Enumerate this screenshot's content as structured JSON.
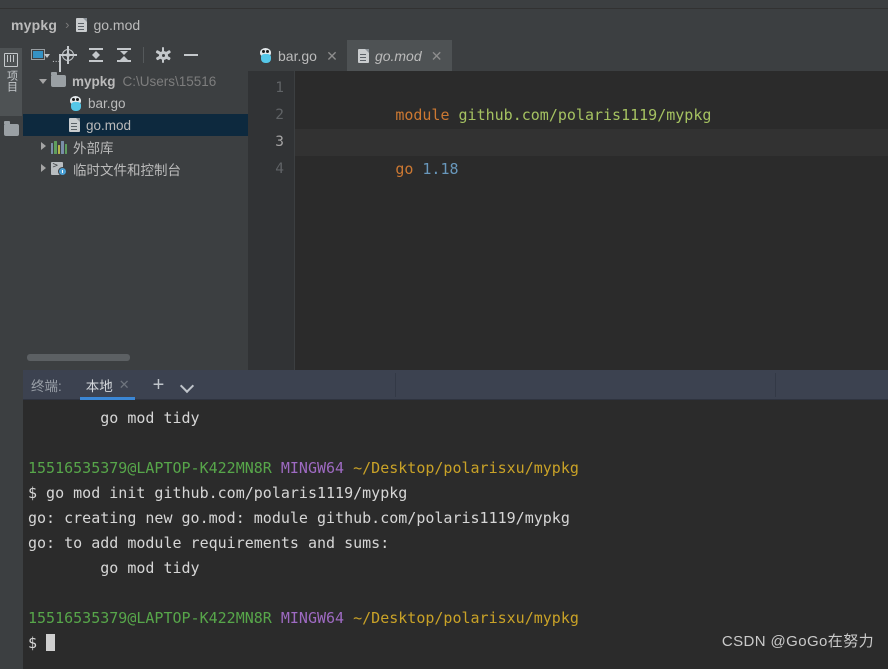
{
  "window": {
    "theme_bg": "#3c3f41",
    "editor_bg": "#2b2b2b",
    "accent": "#3b87d6"
  },
  "breadcrumb": {
    "project": "mypkg",
    "separator": "›",
    "file": "go.mod",
    "file_icon": "file-icon"
  },
  "activity_bar": {
    "project_tab_label": "项目",
    "project_tab_icon": "bookshelf-icon",
    "structure_icon": "folder-icon"
  },
  "project_toolbar": {
    "buttons": [
      {
        "name": "project-view-selector",
        "icon": "project-select-icon",
        "dots": "..."
      },
      {
        "name": "select-opened-file",
        "icon": "locate-target-icon"
      },
      {
        "name": "expand-all",
        "icon": "expand-all-icon"
      },
      {
        "name": "collapse-all",
        "icon": "collapse-all-icon"
      },
      {
        "name": "settings",
        "icon": "gear-icon"
      },
      {
        "name": "hide-panel",
        "icon": "minus-icon"
      }
    ]
  },
  "project_tree": {
    "items": [
      {
        "label": "mypkg",
        "sublabel": "C:\\Users\\15516",
        "icon": "folder-icon",
        "twisty": "down",
        "indent": 0,
        "selected": false,
        "bold": true
      },
      {
        "label": "bar.go",
        "sublabel": "",
        "icon": "go-file-icon",
        "twisty": "none",
        "indent": 1,
        "selected": false,
        "bold": false
      },
      {
        "label": "go.mod",
        "sublabel": "",
        "icon": "file-icon",
        "twisty": "none",
        "indent": 1,
        "selected": true,
        "bold": false
      },
      {
        "label": "外部库",
        "sublabel": "",
        "icon": "library-icon",
        "twisty": "right",
        "indent": 0,
        "selected": false,
        "bold": false
      },
      {
        "label": "临时文件和控制台",
        "sublabel": "",
        "icon": "scratches-icon",
        "twisty": "right",
        "indent": 0,
        "selected": false,
        "bold": false
      }
    ]
  },
  "editor": {
    "tabs": [
      {
        "label": "bar.go",
        "icon": "go-file-icon",
        "active": false,
        "close": "✕"
      },
      {
        "label": "go.mod",
        "icon": "file-icon",
        "active": true,
        "close": "✕"
      }
    ],
    "line_numbers": [
      "1",
      "2",
      "3",
      "4"
    ],
    "current_line": 3,
    "lines": [
      {
        "num": "1",
        "tokens": [
          {
            "t": "module",
            "c": "kw"
          },
          {
            "t": " ",
            "c": ""
          },
          {
            "t": "github.com/polaris1119/mypkg",
            "c": "str"
          }
        ]
      },
      {
        "num": "2",
        "tokens": []
      },
      {
        "num": "3",
        "tokens": [
          {
            "t": "go",
            "c": "kw"
          },
          {
            "t": " ",
            "c": ""
          },
          {
            "t": "1.18",
            "c": "num"
          }
        ]
      },
      {
        "num": "4",
        "tokens": []
      }
    ]
  },
  "terminal": {
    "title": "终端:",
    "tab_label": "本地",
    "tab_close": "✕",
    "add_label": "+",
    "dropdown_icon": "chevron-down-icon",
    "lines": [
      {
        "segments": [
          {
            "t": "        go mod tidy",
            "c": ""
          }
        ]
      },
      {
        "segments": [
          {
            "t": "",
            "c": ""
          }
        ]
      },
      {
        "segments": [
          {
            "t": "15516535379@LAPTOP-K422MN8R",
            "c": "user"
          },
          {
            "t": " ",
            "c": ""
          },
          {
            "t": "MINGW64",
            "c": "host"
          },
          {
            "t": " ",
            "c": ""
          },
          {
            "t": "~/Desktop/polarisxu/mypkg",
            "c": "path"
          }
        ]
      },
      {
        "segments": [
          {
            "t": "$ go mod init github.com/polaris1119/mypkg",
            "c": ""
          }
        ]
      },
      {
        "segments": [
          {
            "t": "go: creating new go.mod: module github.com/polaris1119/mypkg",
            "c": ""
          }
        ]
      },
      {
        "segments": [
          {
            "t": "go: to add module requirements and sums:",
            "c": ""
          }
        ]
      },
      {
        "segments": [
          {
            "t": "        go mod tidy",
            "c": ""
          }
        ]
      },
      {
        "segments": [
          {
            "t": "",
            "c": ""
          }
        ]
      },
      {
        "segments": [
          {
            "t": "15516535379@LAPTOP-K422MN8R",
            "c": "user"
          },
          {
            "t": " ",
            "c": ""
          },
          {
            "t": "MINGW64",
            "c": "host"
          },
          {
            "t": " ",
            "c": ""
          },
          {
            "t": "~/Desktop/polarisxu/mypkg",
            "c": "path"
          }
        ]
      },
      {
        "segments": [
          {
            "t": "$ ",
            "c": ""
          },
          {
            "t": "",
            "c": "cursor"
          }
        ]
      }
    ]
  },
  "watermark": {
    "text": "CSDN @GoGo在努力"
  }
}
